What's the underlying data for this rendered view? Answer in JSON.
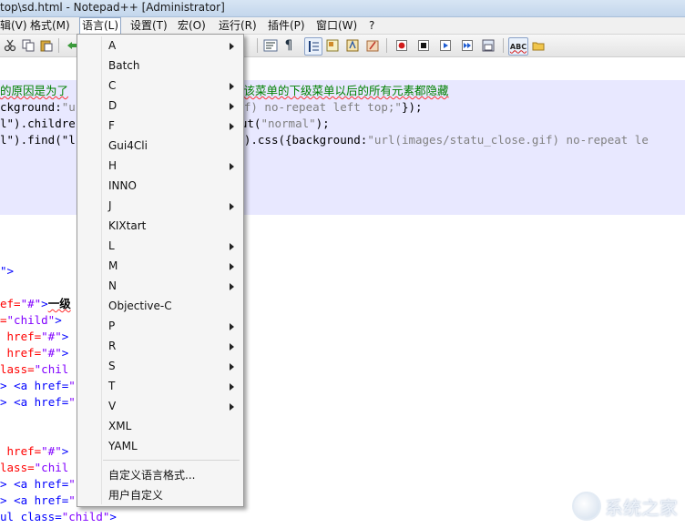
{
  "title": "top\\sd.html - Notepad++ [Administrator]",
  "menubar": [
    {
      "label": "辑(V)"
    },
    {
      "label": "格式(M)"
    },
    {
      "label": "语言(L)"
    },
    {
      "label": "设置(T)"
    },
    {
      "label": "宏(O)"
    },
    {
      "label": "运行(R)"
    },
    {
      "label": "插件(P)"
    },
    {
      "label": "窗口(W)"
    },
    {
      "label": "?"
    }
  ],
  "toolbar_icons": {
    "abc": "ABC"
  },
  "language_menu": {
    "items": [
      {
        "label": "A",
        "submenu": true
      },
      {
        "label": "Batch",
        "submenu": false
      },
      {
        "label": "C",
        "submenu": true
      },
      {
        "label": "D",
        "submenu": true
      },
      {
        "label": "F",
        "submenu": true
      },
      {
        "label": "Gui4Cli",
        "submenu": false
      },
      {
        "label": "H",
        "submenu": true
      },
      {
        "label": "INNO",
        "submenu": false
      },
      {
        "label": "J",
        "submenu": true
      },
      {
        "label": "KIXtart",
        "submenu": false
      },
      {
        "label": "L",
        "submenu": true
      },
      {
        "label": "M",
        "submenu": true
      },
      {
        "label": "N",
        "submenu": true
      },
      {
        "label": "Objective-C",
        "submenu": false
      },
      {
        "label": "P",
        "submenu": true
      },
      {
        "label": "R",
        "submenu": true
      },
      {
        "label": "S",
        "submenu": true
      },
      {
        "label": "T",
        "submenu": true
      },
      {
        "label": "V",
        "submenu": true
      },
      {
        "label": "XML",
        "submenu": false
      },
      {
        "label": "YAML",
        "submenu": false
      }
    ],
    "footer_items": [
      {
        "label": "自定义语言格式..."
      },
      {
        "label": "用户自定义"
      }
    ]
  },
  "code": {
    "l1a": "的原因是为了",
    "l1b": "将该菜单的下级菜单以后的所有元素都隐藏",
    "l2a": "ckground:",
    "l2b": "\"u",
    "l2c": "gif) no-repeat left top;\"",
    "l2d": "});",
    "l3a": "l\").childre",
    "l3b": "eOut(",
    "l3c": "\"normal\"",
    "l3d": ");",
    "l4a": "l\").find(\"l",
    "l4b": "s\").css({background:",
    "l4c": "\"url(images/statu_close.gif) no-repeat le",
    "l5": "\">",
    "l6a": "ef=",
    "l6b": "\"#\"",
    "l6c": ">",
    "l6d": "一级",
    "l7a": "=",
    "l7b": "\"child\"",
    "l7c": ">",
    "l8a": " href=",
    "l8b": "\"#\"",
    "l8c": ">",
    "l9a": " href=",
    "l9b": "\"#\"",
    "l9c": ">",
    "l10a": "lass=",
    "l10b": "\"chil",
    "l11a": "> ",
    "l11b": "<a href=",
    "l11c": "\"",
    "l12a": "> ",
    "l12b": "<a href=",
    "l12c": "\"",
    "l13a": " href=",
    "l13b": "\"#\"",
    "l13c": ">",
    "l14a": "lass=",
    "l14b": "\"chil",
    "l15a": "> ",
    "l15b": "<a href=",
    "l15c": "\"",
    "l16a": "> ",
    "l16b": "<a href=",
    "l16c": "\"",
    "l17a": "ul class=",
    "l17b": "\"child\"",
    "l17c": ">"
  },
  "watermark": "系统之家"
}
